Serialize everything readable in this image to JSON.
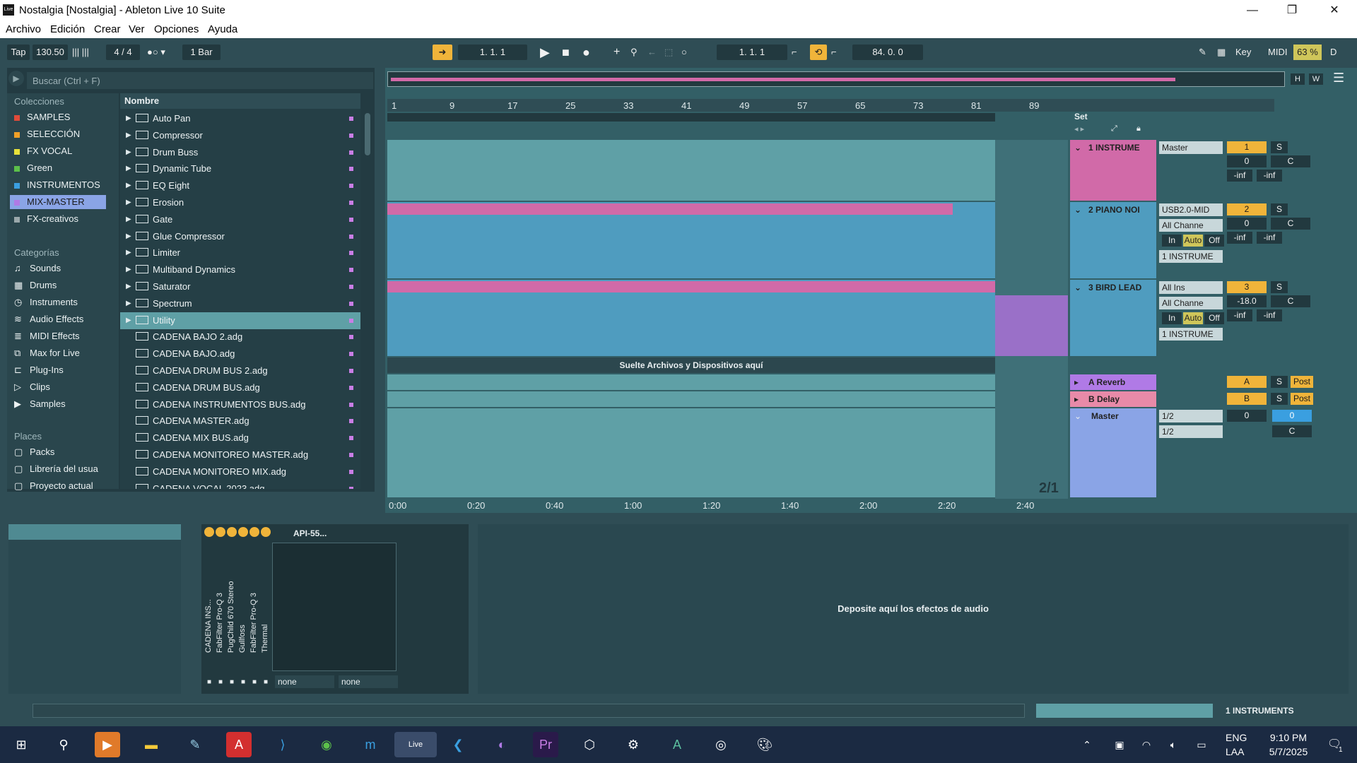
{
  "window": {
    "title": "Nostalgia  [Nostalgia] - Ableton Live 10 Suite",
    "app_icon_text": "Live"
  },
  "menu": [
    "Archivo",
    "Edición",
    "Crear",
    "Ver",
    "Opciones",
    "Ayuda"
  ],
  "transport": {
    "tap": "Tap",
    "tempo": "130.50",
    "signature": "4 / 4",
    "quantize": "1 Bar",
    "arrangement_position": "1.   1.   1",
    "loop_start": "1.   1.   1",
    "loop_length": "84.   0.   0",
    "key": "Key",
    "midi": "MIDI",
    "cpu": "63 %",
    "d": "D"
  },
  "browser": {
    "search_placeholder": "Buscar (Ctrl + F)",
    "collections_label": "Colecciones",
    "collections": [
      {
        "label": "SAMPLES",
        "color": "#e04b3a"
      },
      {
        "label": "SELECCIÓN",
        "color": "#f0a028"
      },
      {
        "label": "FX VOCAL",
        "color": "#e8e23a"
      },
      {
        "label": "Green",
        "color": "#5cc04a"
      },
      {
        "label": "INSTRUMENTOS",
        "color": "#3a9fe0"
      },
      {
        "label": "MIX-MASTER",
        "color": "#b07ae6"
      },
      {
        "label": "FX-creativos",
        "color": "#9aa8ab"
      }
    ],
    "categories_label": "Categorías",
    "categories": [
      "Sounds",
      "Drums",
      "Instruments",
      "Audio Effects",
      "MIDI Effects",
      "Max for Live",
      "Plug-Ins",
      "Clips",
      "Samples"
    ],
    "places_label": "Places",
    "places": [
      "Packs",
      "Librería del usua",
      "Proyecto actual"
    ],
    "column_header": "Nombre",
    "items": [
      {
        "label": "Auto Pan",
        "type": "folder"
      },
      {
        "label": "Compressor",
        "type": "folder"
      },
      {
        "label": "Drum Buss",
        "type": "folder"
      },
      {
        "label": "Dynamic Tube",
        "type": "folder"
      },
      {
        "label": "EQ Eight",
        "type": "folder"
      },
      {
        "label": "Erosion",
        "type": "folder"
      },
      {
        "label": "Gate",
        "type": "folder"
      },
      {
        "label": "Glue Compressor",
        "type": "folder"
      },
      {
        "label": "Limiter",
        "type": "folder"
      },
      {
        "label": "Multiband Dynamics",
        "type": "folder"
      },
      {
        "label": "Saturator",
        "type": "folder"
      },
      {
        "label": "Spectrum",
        "type": "folder"
      },
      {
        "label": "Utility",
        "type": "folder",
        "selected": true
      },
      {
        "label": "CADENA BAJO 2.adg",
        "type": "file"
      },
      {
        "label": "CADENA BAJO.adg",
        "type": "file"
      },
      {
        "label": "CADENA DRUM BUS 2.adg",
        "type": "file"
      },
      {
        "label": "CADENA DRUM BUS.adg",
        "type": "file"
      },
      {
        "label": "CADENA INSTRUMENTOS BUS.adg",
        "type": "file"
      },
      {
        "label": "CADENA MASTER.adg",
        "type": "file"
      },
      {
        "label": "CADENA MIX BUS.adg",
        "type": "file"
      },
      {
        "label": "CADENA MONITOREO MASTER.adg",
        "type": "file"
      },
      {
        "label": "CADENA MONITOREO MIX.adg",
        "type": "file"
      },
      {
        "label": "CADENA VOCAL 2023.adg",
        "type": "file"
      }
    ]
  },
  "arrangement": {
    "bars": [
      "1",
      "9",
      "17",
      "25",
      "33",
      "41",
      "49",
      "57",
      "65",
      "73",
      "81",
      "89"
    ],
    "set_label": "Set",
    "drop_hint": "Suelte Archivos y Dispositivos aquí",
    "time_labels": [
      "0:00",
      "0:20",
      "0:40",
      "1:00",
      "1:20",
      "1:40",
      "2:00",
      "2:20",
      "2:40"
    ],
    "zoom_label": "2/1",
    "overview_h": "H",
    "overview_w": "W"
  },
  "tracks": [
    {
      "name": "1 INSTRUME",
      "color": "#d16aa8",
      "io1": "Master",
      "num": "1",
      "vol": "0",
      "pan": "C",
      "peak1": "-inf",
      "peak2": "-inf"
    },
    {
      "name": "2 PIANO NOI",
      "color": "#4f9cbf",
      "io1": "USB2.0-MID",
      "io2": "All Channe",
      "io3": "1 INSTRUME",
      "num": "2",
      "vol": "0",
      "pan": "C",
      "peak1": "-inf",
      "peak2": "-inf",
      "mon": [
        "In",
        "Auto",
        "Off"
      ]
    },
    {
      "name": "3 BIRD LEAD",
      "color": "#4f9cbf",
      "io1": "All Ins",
      "io2": "All Channe",
      "io3": "1 INSTRUME",
      "num": "3",
      "vol": "-18.0",
      "pan": "C",
      "peak1": "-inf",
      "peak2": "-inf",
      "mon": [
        "In",
        "Auto",
        "Off"
      ]
    }
  ],
  "returns": [
    {
      "name": "A Reverb",
      "color": "#b07ae6",
      "letter": "A",
      "post": "Post"
    },
    {
      "name": "B Delay",
      "color": "#e88aa8",
      "letter": "B",
      "post": "Post"
    }
  ],
  "master": {
    "name": "Master",
    "color": "#8aa4e6",
    "cue1": "1/2",
    "cue2": "1/2",
    "vol": "0",
    "vol2": "0",
    "pan": "C"
  },
  "rack": {
    "title": "API-55...",
    "chains": [
      "CADENA INS...",
      "FabFilter Pro-Q 3",
      "PugChild 670 Stereo",
      "Gullfoss",
      "FabFilter Pro-Q 3",
      "Thermal"
    ],
    "sel1": "none",
    "sel2": "none"
  },
  "device_drop_hint": "Deposite aquí los efectos de audio",
  "status_track": "1 INSTRUMENTS",
  "tray": {
    "lang1": "ENG",
    "lang2": "LAA",
    "time": "9:10 PM",
    "date": "5/7/2025",
    "notif": "1"
  }
}
